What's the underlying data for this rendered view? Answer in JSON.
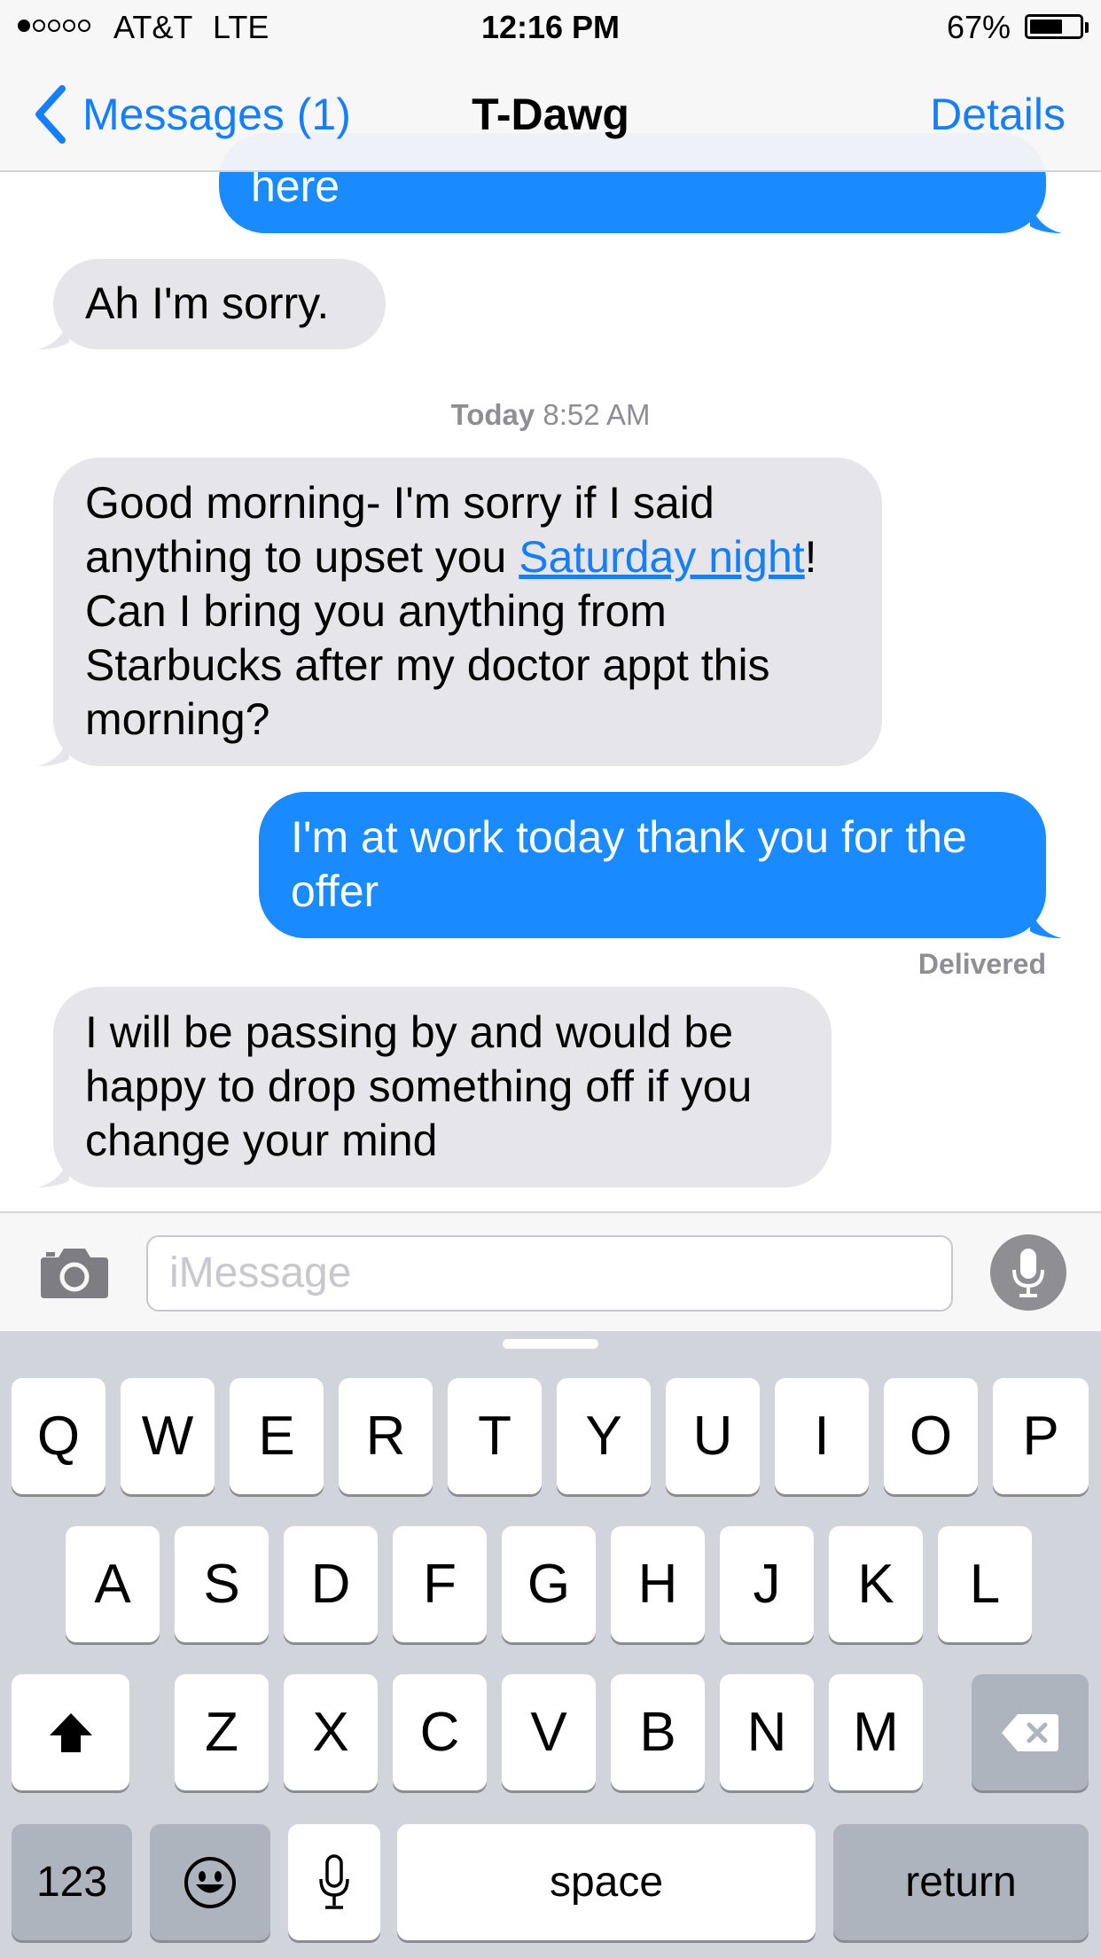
{
  "status_bar": {
    "signal_strength": 1,
    "signal_max": 5,
    "carrier": "AT&T",
    "network": "LTE",
    "time": "12:16 PM",
    "battery_percent": "67%",
    "battery_level": 0.67
  },
  "nav": {
    "back_label": "Messages (1)",
    "title": "T-Dawg",
    "details_label": "Details"
  },
  "messages": {
    "m0": {
      "direction": "sent",
      "lines": [
        "here"
      ]
    },
    "m1": {
      "direction": "received",
      "lines": [
        "Ah I'm sorry."
      ]
    },
    "timestamp": {
      "day": "Today",
      "time": "8:52 AM"
    },
    "m2": {
      "direction": "received",
      "line1": "Good morning- I'm sorry if I said",
      "line2_before": "anything to upset you ",
      "line2_link": "Saturday night",
      "line2_after": "!",
      "line3": "Can I bring you anything from",
      "line4": "Starbucks after my doctor appt this",
      "line5": "morning?"
    },
    "m3": {
      "direction": "sent",
      "lines": [
        "I'm at work today thank you for the",
        "offer"
      ]
    },
    "receipt": "Delivered",
    "m4": {
      "direction": "received",
      "lines": [
        "I will be passing by and would be",
        "happy to drop something off if you",
        "change your mind"
      ]
    }
  },
  "input_bar": {
    "placeholder": "iMessage",
    "camera_icon": "camera-icon",
    "dictation_icon": "microphone-icon"
  },
  "keyboard": {
    "row1": [
      "Q",
      "W",
      "E",
      "R",
      "T",
      "Y",
      "U",
      "I",
      "O",
      "P"
    ],
    "row2": [
      "A",
      "S",
      "D",
      "F",
      "G",
      "H",
      "J",
      "K",
      "L"
    ],
    "row3": [
      "Z",
      "X",
      "C",
      "V",
      "B",
      "N",
      "M"
    ],
    "numbers_label": "123",
    "space_label": "space",
    "return_label": "return",
    "icons": [
      "shift-icon",
      "delete-icon",
      "emoji-icon",
      "microphone-icon"
    ]
  },
  "colors": {
    "accent": "#147efb",
    "sent_bubble": "#1a8aff",
    "received_bubble": "#e5e5ea",
    "keyboard_bg": "#d1d5db",
    "secondary_text": "#8e8e93"
  }
}
